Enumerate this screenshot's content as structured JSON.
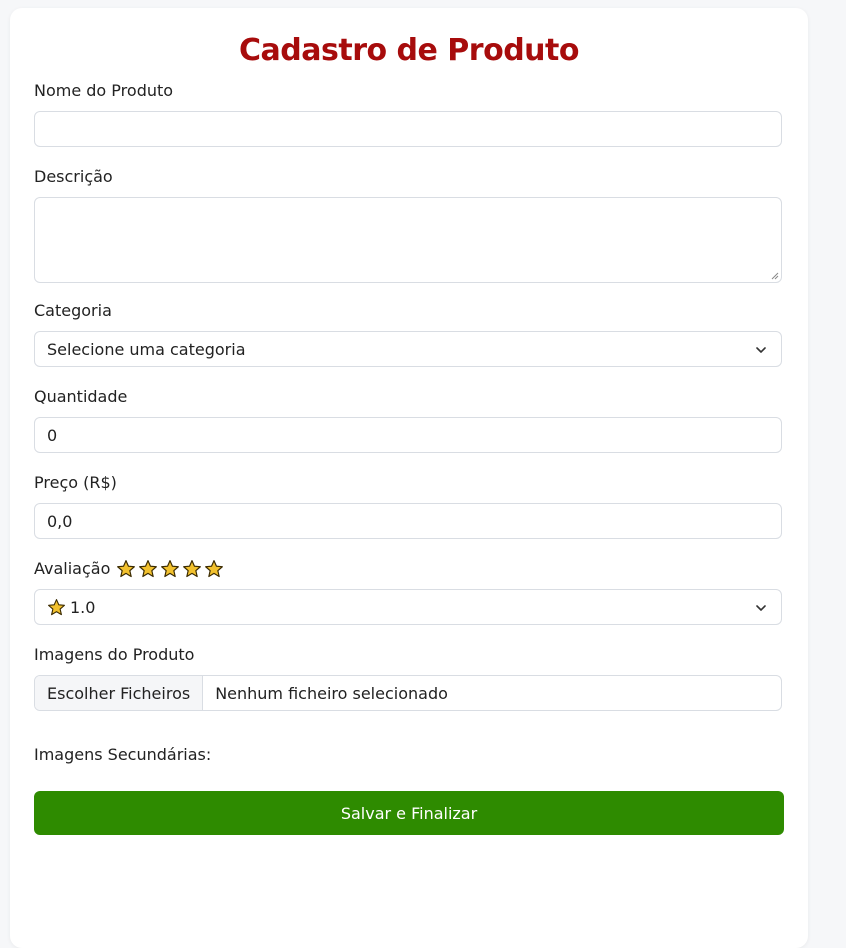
{
  "form": {
    "title": "Cadastro de Produto",
    "name": {
      "label": "Nome do Produto",
      "value": ""
    },
    "description": {
      "label": "Descrição",
      "value": ""
    },
    "category": {
      "label": "Categoria",
      "selected": "Selecione uma categoria"
    },
    "quantity": {
      "label": "Quantidade",
      "value": "0"
    },
    "price": {
      "label": "Preço (R$)",
      "value": "0,0"
    },
    "rating": {
      "label": "Avaliação",
      "stars_shown": 5,
      "selected": "1.0",
      "star_color": "#f2c12e"
    },
    "images": {
      "label": "Imagens do Produto",
      "button": "Escolher Ficheiros",
      "status": "Nenhum ficheiro selecionado"
    },
    "secondary_images": {
      "label": "Imagens Secundárias:"
    },
    "submit": {
      "label": "Salvar e Finalizar",
      "color": "#2e8b00"
    }
  },
  "colors": {
    "title": "#a70c0c",
    "background": "#f6f7f9",
    "card": "#ffffff"
  }
}
